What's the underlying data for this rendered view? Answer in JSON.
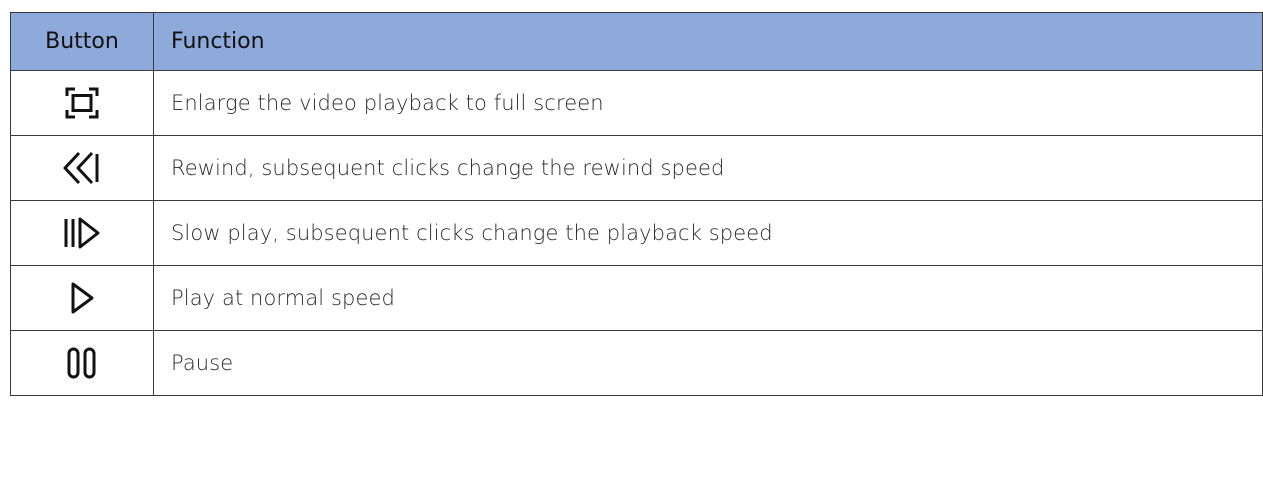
{
  "table": {
    "headers": {
      "button": "Button",
      "function": "Function"
    },
    "rows": [
      {
        "icon": "fullscreen-icon",
        "function": "Enlarge the video playback to full screen"
      },
      {
        "icon": "rewind-icon",
        "function": "Rewind, subsequent clicks change the rewind speed"
      },
      {
        "icon": "slow-play-icon",
        "function": "Slow play, subsequent clicks change the playback speed"
      },
      {
        "icon": "play-icon",
        "function": "Play at normal speed"
      },
      {
        "icon": "pause-icon",
        "function": "Pause"
      }
    ]
  },
  "colors": {
    "header_background": "#8eaadb",
    "border": "#3a3a3a",
    "icon": "#111111"
  }
}
